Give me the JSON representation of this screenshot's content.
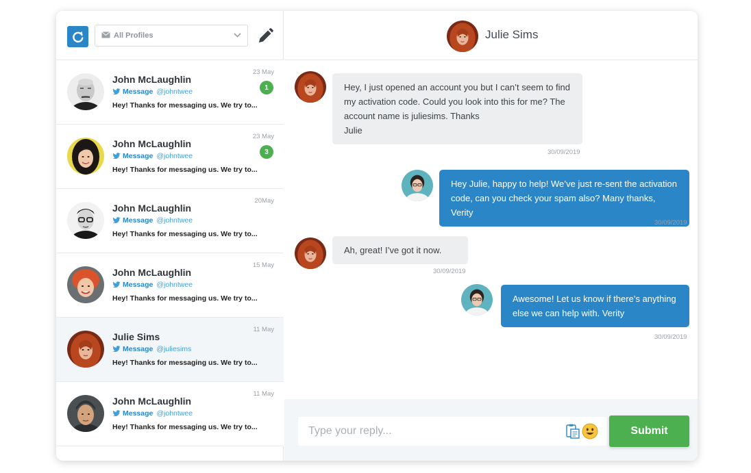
{
  "sidebar": {
    "profile_select": {
      "value": "All Profiles"
    },
    "conversations": [
      {
        "name": "John McLaughlin",
        "kind": "Message",
        "handle": "@johntwee",
        "preview": "Hey! Thanks for messaging us. We try to...",
        "date": "23 May",
        "unread": "1",
        "avatar": "man-bald-avatar"
      },
      {
        "name": "John McLaughlin",
        "kind": "Message",
        "handle": "@johntwee",
        "preview": "Hey! Thanks for messaging us. We try to...",
        "date": "23 May",
        "unread": "3",
        "avatar": "woman-dark-hair-avatar"
      },
      {
        "name": "John McLaughlin",
        "kind": "Message",
        "handle": "@johntwee",
        "preview": "Hey! Thanks for messaging us. We try to...",
        "date": "20May",
        "avatar": "man-glasses-avatar"
      },
      {
        "name": "John McLaughlin",
        "kind": "Message",
        "handle": "@johntwee",
        "preview": "Hey! Thanks for messaging us. We try to...",
        "date": "15 May",
        "avatar": "woman-red-hair-avatar"
      },
      {
        "name": "Julie Sims",
        "kind": "Message",
        "handle": "@juliesims",
        "preview": "Hey! Thanks for messaging us. We try to...",
        "date": "11 May",
        "avatar": "julie-avatar",
        "active": true
      },
      {
        "name": "John McLaughlin",
        "kind": "Message",
        "handle": "@johntwee",
        "preview": "Hey! Thanks for messaging us. We try to...",
        "date": "11 May",
        "avatar": "man-beanie-avatar"
      }
    ]
  },
  "chat": {
    "contact_name": "Julie Sims",
    "messages": [
      {
        "direction": "in",
        "text": "Hey, I just opened an account you but I can’t seem to find\nmy activation code. Could you look into this for me? The\naccount name is juliesims. Thanks\nJulie",
        "time": "30/09/2019"
      },
      {
        "direction": "out",
        "text": "Hey Julie, happy to help! We’ve just re-sent the activation\ncode, can you check your spam also? Many thanks, Verity",
        "time": "30/09/2019"
      },
      {
        "direction": "in",
        "text": "Ah, great! I’ve got it now.",
        "time": "30/09/2019"
      },
      {
        "direction": "out",
        "text": "Awesome! Let us know if there’s anything\nelse we can help with. Verity",
        "time": "30/09/2019"
      }
    ]
  },
  "composer": {
    "placeholder": "Type your reply...",
    "submit_label": "Submit"
  },
  "colors": {
    "brand_blue": "#2b86c8",
    "twitter_blue": "#3fa0dd",
    "success_green": "#4caf50",
    "incoming_bubble": "#eceef0"
  }
}
